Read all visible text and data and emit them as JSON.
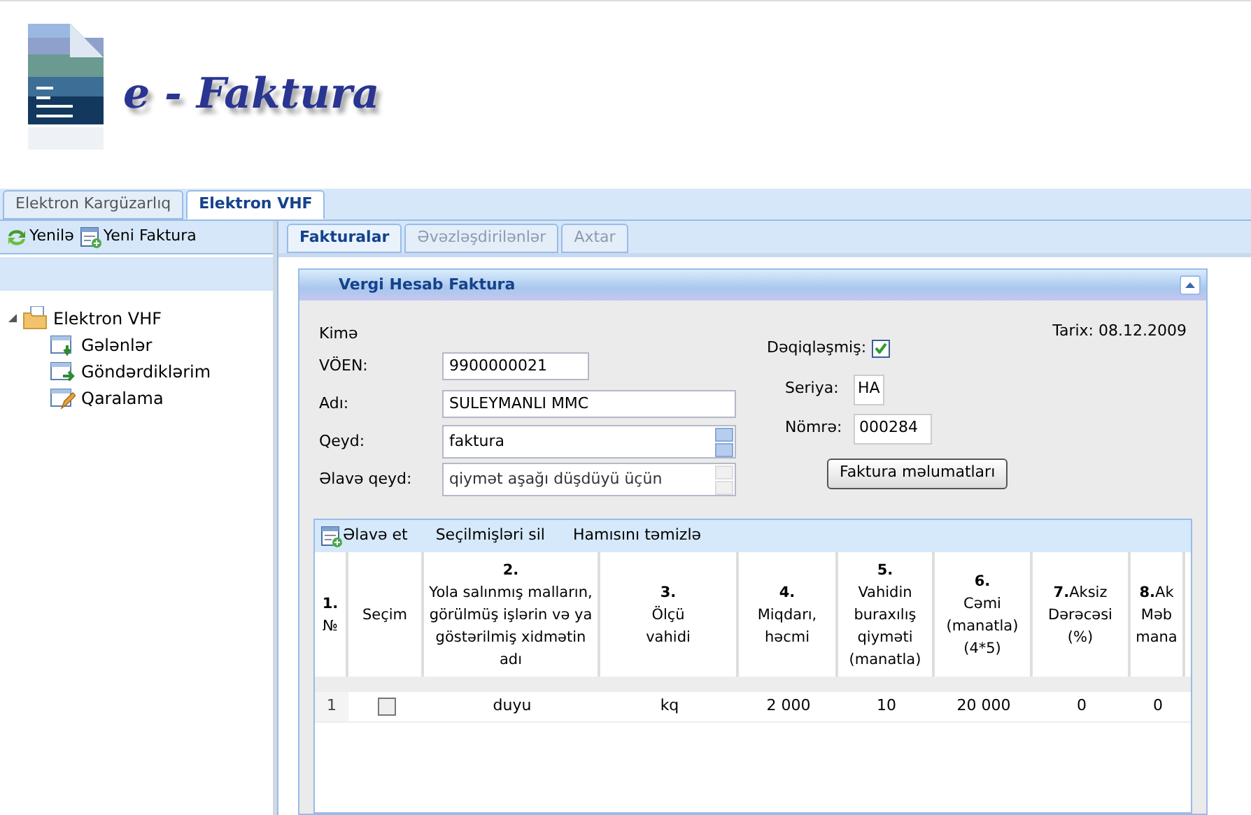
{
  "logo": {
    "title": "e - Faktura"
  },
  "top_tabs": [
    {
      "label": "Elektron Kargüzarlıq",
      "selected": false
    },
    {
      "label": "Elektron VHF",
      "selected": true
    }
  ],
  "sidebar": {
    "toolbar": [
      {
        "label": "Yenilə",
        "kind": "refresh"
      },
      {
        "label": "Yeni Faktura",
        "kind": "new"
      }
    ],
    "tree": [
      {
        "label": "Elektron VHF",
        "kind": "folder",
        "expanded": true,
        "children": [
          {
            "label": "Gələnlər",
            "kind": "inbox"
          },
          {
            "label": "Göndərdiklərim",
            "kind": "sent"
          },
          {
            "label": "Qaralama",
            "kind": "draft"
          }
        ]
      }
    ]
  },
  "main_tabs": [
    {
      "label": "Fakturalar",
      "selected": true
    },
    {
      "label": "Əvəzləşdirilənlər",
      "selected": false
    },
    {
      "label": "Axtar",
      "selected": false
    }
  ],
  "panel": {
    "title": "Vergi Hesab Faktura",
    "date": "Tarix: 08.12.2009",
    "recipient_label": "Kimə",
    "fields": [
      {
        "label": "VÖEN:",
        "value": "9900000021",
        "kind": "short"
      },
      {
        "label": "Adı:",
        "value": "SULEYMANLI MMC",
        "kind": "long"
      },
      {
        "label": "Qeyd:",
        "value": "faktura",
        "kind": "spin",
        "disabled": false
      },
      {
        "label": "Əlavə qeyd:",
        "value": "qiymət aşağı düşdüyü üçün",
        "kind": "spin",
        "disabled": true
      }
    ],
    "confirmed": {
      "label": "Dəqiqləşmiş:",
      "checked": true
    },
    "series": {
      "label": "Seriya:",
      "value": "HA"
    },
    "number": {
      "label": "Nömrə:",
      "value": "000284"
    },
    "details_button": "Faktura məlumatları"
  },
  "grid": {
    "toolbar": [
      {
        "label": "Əlavə et",
        "kind": "add"
      },
      {
        "label": "Seçilmişləri sil",
        "kind": "text"
      },
      {
        "label": "Hamısını təmizlə",
        "kind": "text"
      }
    ],
    "columns": [
      {
        "lines": [
          "**1.**",
          "№"
        ]
      },
      {
        "lines": [
          "Seçim"
        ]
      },
      {
        "lines": [
          "**2.**",
          "Yola salınmış malların,",
          "görülmüş işlərin və ya",
          "göstərilmiş xidmətin",
          "adı"
        ]
      },
      {
        "lines": [
          "**3.**",
          "Ölçü",
          "vahidi"
        ]
      },
      {
        "lines": [
          "**4.**",
          "Miqdarı,",
          "həcmi"
        ]
      },
      {
        "lines": [
          "**5.**",
          "Vahidin",
          "buraxılış",
          "qiyməti",
          "(manatla)"
        ]
      },
      {
        "lines": [
          "**6.**",
          "Cəmi",
          "(manatla)",
          "(4*5)"
        ]
      },
      {
        "lines": [
          "**7.**Aksiz",
          "Dərəcəsi",
          "(%)"
        ]
      },
      {
        "lines": [
          "**8.**Ak",
          "Məb",
          "mana"
        ]
      }
    ],
    "rows": [
      {
        "cells": [
          "1",
          "",
          "duyu",
          "kq",
          "2 000",
          "10",
          "20 000",
          "0",
          "0"
        ],
        "checked": false
      }
    ]
  }
}
